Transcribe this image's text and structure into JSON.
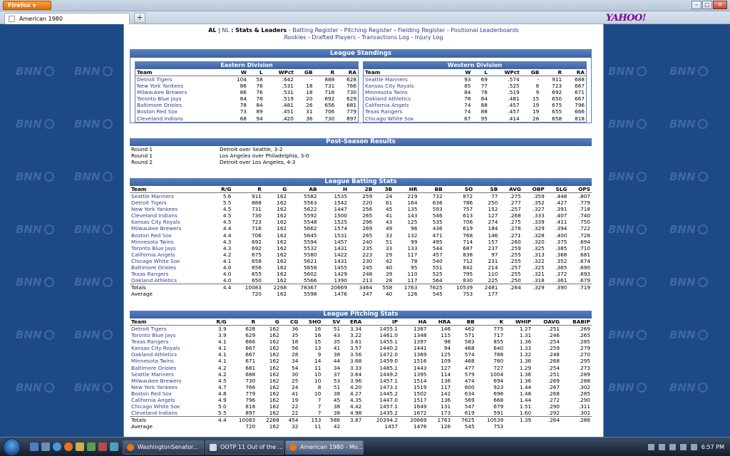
{
  "browser": {
    "menu_label": "Firefox",
    "tab_title": "American 1980",
    "new_tab": "+",
    "search_logo": "YAHOO!"
  },
  "watermark": "BNN",
  "nav": {
    "league_al": "AL",
    "sep1": "|",
    "league_nl": "NL",
    "current": ": Stats & Leaders",
    "links_row1": [
      "Batting Register",
      "Pitching Register",
      "Fielding Register",
      "Positional Leaderboards"
    ],
    "links_row2": [
      "Rookies",
      "Drafted Players",
      "Transactions Log",
      "Injury Log"
    ],
    "dash": " - "
  },
  "standings": {
    "title": "League Standings",
    "columns": [
      "Team",
      "W",
      "L",
      "WPct",
      "GB",
      "R",
      "RA"
    ],
    "east": {
      "title": "Eastern Division",
      "rows": [
        [
          "Detroit Tigers",
          "104",
          "58",
          ".642",
          "-",
          "888",
          "628"
        ],
        [
          "New York Yankees",
          "86",
          "76",
          ".531",
          "18",
          "731",
          "766"
        ],
        [
          "Milwaukee Brewers",
          "86",
          "76",
          ".531",
          "18",
          "716",
          "730"
        ],
        [
          "Toronto Blue Jays",
          "84",
          "78",
          ".519",
          "20",
          "692",
          "629"
        ],
        [
          "Baltimore Orioles",
          "78",
          "84",
          ".481",
          "26",
          "656",
          "681"
        ],
        [
          "Boston Red Sox",
          "73",
          "89",
          ".451",
          "31",
          "706",
          "779"
        ],
        [
          "Cleveland Indians",
          "68",
          "94",
          ".420",
          "36",
          "730",
          "897"
        ]
      ]
    },
    "west": {
      "title": "Western Division",
      "rows": [
        [
          "Seattle Mariners",
          "93",
          "69",
          ".574",
          "-",
          "911",
          "688"
        ],
        [
          "Kansas City Royals",
          "85",
          "77",
          ".525",
          "8",
          "723",
          "667"
        ],
        [
          "Minnesota Twins",
          "84",
          "78",
          ".519",
          "9",
          "692",
          "671"
        ],
        [
          "Oakland Athletics",
          "78",
          "84",
          ".481",
          "15",
          "650",
          "667"
        ],
        [
          "California Angels",
          "74",
          "88",
          ".457",
          "19",
          "675",
          "796"
        ],
        [
          "Texas Rangers",
          "74",
          "88",
          ".457",
          "19",
          "655",
          "666"
        ],
        [
          "Chicago White Sox",
          "67",
          "95",
          ".414",
          "26",
          "658",
          "818"
        ]
      ]
    }
  },
  "postseason": {
    "title": "Post-Season Results",
    "rows": [
      [
        "Round 1",
        "Detroit over Seattle, 3-2"
      ],
      [
        "Round 1",
        "Los Angeles over Philadelphia, 3-0"
      ],
      [
        "Round 2",
        "Detroit over Los Angeles, 4-3"
      ]
    ]
  },
  "batting": {
    "title": "League Batting Stats",
    "columns": [
      "Team",
      "R/G",
      "R",
      "G",
      "AB",
      "H",
      "2B",
      "3B",
      "HR",
      "BB",
      "SO",
      "SB",
      "AVG",
      "OBP",
      "SLG",
      "OPS"
    ],
    "rows": [
      [
        "Seattle Mariners",
        "5.6",
        "911",
        "162",
        "5582",
        "1535",
        "259",
        "24",
        "219",
        "732",
        "872",
        "77",
        ".275",
        ".359",
        ".448",
        ".807"
      ],
      [
        "Detroit Tigers",
        "5.5",
        "888",
        "162",
        "5563",
        "1542",
        "220",
        "61",
        "164",
        "636",
        "786",
        "250",
        ".277",
        ".352",
        ".427",
        ".779"
      ],
      [
        "New York Yankees",
        "4.5",
        "731",
        "162",
        "5622",
        "1447",
        "256",
        "45",
        "135",
        "593",
        "757",
        "152",
        ".257",
        ".327",
        ".391",
        ".718"
      ],
      [
        "Cleveland Indians",
        "4.5",
        "730",
        "162",
        "5592",
        "1500",
        "265",
        "41",
        "143",
        "546",
        "613",
        "127",
        ".268",
        ".333",
        ".407",
        ".740"
      ],
      [
        "Kansas City Royals",
        "4.5",
        "723",
        "162",
        "5548",
        "1525",
        "296",
        "43",
        "125",
        "535",
        "706",
        "274",
        ".275",
        ".339",
        ".411",
        ".750"
      ],
      [
        "Milwaukee Brewers",
        "4.4",
        "716",
        "162",
        "5662",
        "1574",
        "269",
        "49",
        "96",
        "436",
        "619",
        "184",
        ".278",
        ".329",
        ".394",
        ".722"
      ],
      [
        "Boston Red Sox",
        "4.4",
        "706",
        "162",
        "5645",
        "1531",
        "265",
        "33",
        "132",
        "471",
        "768",
        "146",
        ".271",
        ".328",
        ".400",
        ".728"
      ],
      [
        "Minnesota Twins",
        "4.3",
        "692",
        "162",
        "5594",
        "1457",
        "240",
        "51",
        "99",
        "495",
        "714",
        "157",
        ".260",
        ".320",
        ".375",
        ".694"
      ],
      [
        "Toronto Blue Jays",
        "4.3",
        "692",
        "162",
        "5532",
        "1431",
        "235",
        "33",
        "133",
        "544",
        "687",
        "237",
        ".259",
        ".325",
        ".385",
        ".710"
      ],
      [
        "California Angels",
        "4.2",
        "675",
        "162",
        "5580",
        "1422",
        "223",
        "29",
        "117",
        "457",
        "838",
        "97",
        ".255",
        ".313",
        ".368",
        ".681"
      ],
      [
        "Chicago White Sox",
        "4.1",
        "658",
        "162",
        "5621",
        "1431",
        "230",
        "42",
        "78",
        "540",
        "712",
        "231",
        ".255",
        ".322",
        ".352",
        ".674"
      ],
      [
        "Baltimore Orioles",
        "4.0",
        "656",
        "162",
        "5658",
        "1455",
        "245",
        "40",
        "95",
        "551",
        "842",
        "214",
        ".257",
        ".325",
        ".365",
        ".690"
      ],
      [
        "Texas Rangers",
        "4.0",
        "655",
        "162",
        "5602",
        "1429",
        "248",
        "39",
        "110",
        "525",
        "795",
        "110",
        ".255",
        ".321",
        ".372",
        ".693"
      ],
      [
        "Oakland Athletics",
        "4.0",
        "650",
        "162",
        "5566",
        "1390",
        "213",
        "28",
        "117",
        "564",
        "830",
        "225",
        ".250",
        ".318",
        ".361",
        ".679"
      ]
    ],
    "totals": [
      "Totals",
      "4.4",
      "10083",
      "2268",
      "78367",
      "20669",
      "3464",
      "558",
      "1763",
      "7625",
      "10539",
      "2481",
      ".264",
      ".329",
      ".390",
      ".719"
    ],
    "average": [
      "Average",
      "",
      "720",
      "162",
      "5598",
      "1476",
      "247",
      "40",
      "126",
      "545",
      "753",
      "177",
      "",
      "",
      "",
      ""
    ]
  },
  "pitching": {
    "title": "League Pitching Stats",
    "columns": [
      "Team",
      "R/G",
      "R",
      "G",
      "CG",
      "SHO",
      "SV",
      "ERA",
      "IP",
      "HA",
      "HRA",
      "BB",
      "K",
      "WHIP",
      "OAVG",
      "BABIP"
    ],
    "rows": [
      [
        "Detroit Tigers",
        "3.9",
        "628",
        "162",
        "36",
        "16",
        "51",
        "3.34",
        "1455.1",
        "1387",
        "146",
        "462",
        "775",
        "1.27",
        ".251",
        ".269"
      ],
      [
        "Toronto Blue Jays",
        "3.9",
        "629",
        "162",
        "35",
        "16",
        "43",
        "3.22",
        "1461.0",
        "1348",
        "115",
        "571",
        "717",
        "1.31",
        ".246",
        ".265"
      ],
      [
        "Texas Rangers",
        "4.1",
        "666",
        "162",
        "18",
        "15",
        "35",
        "3.61",
        "1455.1",
        "1397",
        "98",
        "583",
        "855",
        "1.36",
        ".254",
        ".285"
      ],
      [
        "Kansas City Royals",
        "4.1",
        "667",
        "162",
        "56",
        "13",
        "41",
        "3.57",
        "1440.2",
        "1441",
        "94",
        "468",
        "640",
        "1.33",
        ".259",
        ".279"
      ],
      [
        "Oakland Athletics",
        "4.1",
        "667",
        "162",
        "28",
        "9",
        "38",
        "3.56",
        "1472.0",
        "1369",
        "125",
        "574",
        "788",
        "1.32",
        ".248",
        ".270"
      ],
      [
        "Minnesota Twins",
        "4.1",
        "671",
        "162",
        "34",
        "14",
        "44",
        "3.68",
        "1459.0",
        "1516",
        "109",
        "468",
        "780",
        "1.36",
        ".268",
        ".295"
      ],
      [
        "Baltimore Orioles",
        "4.2",
        "681",
        "162",
        "54",
        "11",
        "34",
        "3.33",
        "1485.1",
        "1443",
        "127",
        "477",
        "727",
        "1.29",
        ".254",
        ".273"
      ],
      [
        "Seattle Mariners",
        "4.2",
        "688",
        "162",
        "30",
        "10",
        "37",
        "3.64",
        "1449.2",
        "1395",
        "114",
        "579",
        "1004",
        "1.36",
        ".251",
        ".289"
      ],
      [
        "Milwaukee Brewers",
        "4.5",
        "730",
        "162",
        "25",
        "10",
        "53",
        "3.96",
        "1457.1",
        "1514",
        "136",
        "474",
        "694",
        "1.36",
        ".269",
        ".288"
      ],
      [
        "New York Yankees",
        "4.7",
        "766",
        "162",
        "24",
        "8",
        "51",
        "4.20",
        "1473.1",
        "1519",
        "117",
        "600",
        "923",
        "1.44",
        ".267",
        ".302"
      ],
      [
        "Boston Red Sox",
        "4.8",
        "779",
        "162",
        "41",
        "10",
        "38",
        "4.27",
        "1445.2",
        "1502",
        "142",
        "634",
        "698",
        "1.48",
        ".268",
        ".285"
      ],
      [
        "California Angels",
        "4.9",
        "796",
        "162",
        "19",
        "7",
        "45",
        "4.35",
        "1447.0",
        "1517",
        "136",
        "569",
        "668",
        "1.44",
        ".272",
        ".290"
      ],
      [
        "Chicago White Sox",
        "5.0",
        "818",
        "162",
        "22",
        "7",
        "38",
        "4.42",
        "1457.1",
        "1649",
        "131",
        "547",
        "679",
        "1.51",
        ".290",
        ".311"
      ],
      [
        "Cleveland Indians",
        "5.5",
        "897",
        "162",
        "22",
        "7",
        "38",
        "4.98",
        "1435.2",
        "1672",
        "173",
        "619",
        "591",
        "1.60",
        ".292",
        ".302"
      ]
    ],
    "totals": [
      "Totals",
      "4.4",
      "10083",
      "2268",
      "454",
      "153",
      "586",
      "3.87",
      "20394.2",
      "20669",
      "1763",
      "7625",
      "10539",
      "1.39",
      ".264",
      ".286"
    ],
    "average": [
      "Average",
      "",
      "720",
      "162",
      "32",
      "11",
      "42",
      "",
      "1457",
      "1476",
      "126",
      "545",
      "753",
      "",
      "",
      ""
    ]
  },
  "taskbar": {
    "tasks": [
      "WashingtonSenator...",
      "OOTP 11 Out of the ...",
      "American 1980 - Mo..."
    ],
    "clock": "6:57 PM"
  }
}
